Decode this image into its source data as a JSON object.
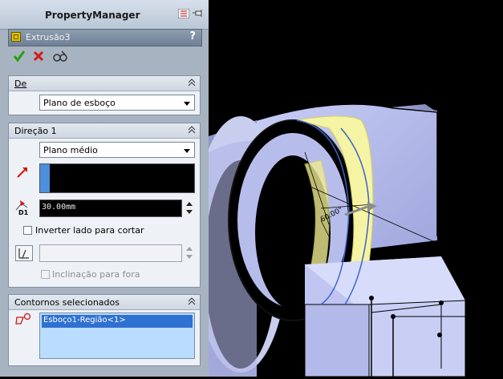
{
  "property_manager": {
    "title": "PropertyManager",
    "feature_name": "Extrusão3",
    "help_label": "?",
    "actions": {
      "ok_icon": "checkmark-icon",
      "cancel_icon": "x-icon",
      "preview_icon": "glasses-icon"
    },
    "from_group": {
      "title": "De",
      "dropdown_value": "Plano de esboço"
    },
    "direction1_group": {
      "title": "Direção 1",
      "end_condition": "Plano médio",
      "depth_value": "30.00mm",
      "depth_icon_label": "D1",
      "flip_side_label": "Inverter lado para cortar",
      "draft_outward_label": "Inclinação para fora"
    },
    "contours_group": {
      "title": "Contornos selecionados",
      "items": [
        "Esboço1-Região<1>"
      ]
    }
  },
  "viewport": {
    "angle_label": "60.00°",
    "colors": {
      "body": "#bcc4ef",
      "highlight": "#f3f19a",
      "background": "#000000"
    }
  }
}
